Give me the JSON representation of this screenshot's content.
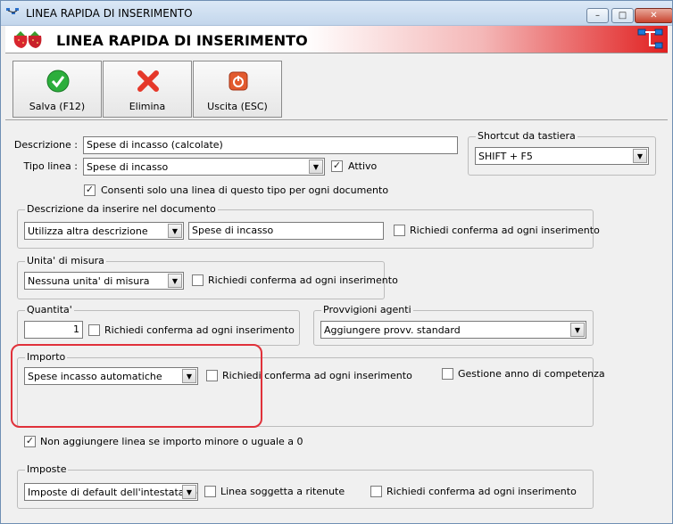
{
  "window": {
    "title": "LINEA RAPIDA DI INSERIMENTO",
    "minimize": "–",
    "maximize": "□",
    "close": "✕"
  },
  "banner": {
    "title": "LINEA RAPIDA DI INSERIMENTO"
  },
  "toolbar": {
    "save_label": "Salva (F12)",
    "delete_label": "Elimina",
    "exit_label": "Uscita (ESC)"
  },
  "form": {
    "description_label": "Descrizione :",
    "description_value": "Spese di incasso  (calcolate)",
    "type_label": "Tipo linea :",
    "type_value": "Spese di incasso",
    "active_label": "Attivo",
    "active_checked": true,
    "single_line_label": "Consenti solo una linea di questo tipo per ogni documento",
    "single_line_checked": true
  },
  "shortcut": {
    "legend": "Shortcut da tastiera",
    "value": "SHIFT + F5"
  },
  "descrizione_doc": {
    "legend": "Descrizione da inserire nel documento",
    "mode_value": "Utilizza altra descrizione",
    "text_value": "Spese di incasso",
    "confirm_label": "Richiedi conferma ad ogni inserimento"
  },
  "unita": {
    "legend": "Unita' di misura",
    "value": "Nessuna unita' di misura",
    "confirm_label": "Richiedi conferma ad ogni inserimento"
  },
  "quantita": {
    "legend": "Quantita'",
    "value": "1",
    "confirm_label": "Richiedi conferma ad ogni inserimento"
  },
  "provvigioni": {
    "legend": "Provvigioni agenti",
    "value": "Aggiungere provv. standard"
  },
  "importo": {
    "legend": "Importo",
    "value": "Spese incasso automatiche",
    "confirm_label": "Richiedi conferma ad ogni inserimento",
    "gestione_label": "Gestione anno di competenza",
    "no_add_label": "Non aggiungere linea se importo minore o uguale a 0",
    "no_add_checked": true
  },
  "imposte": {
    "legend": "Imposte",
    "value": "Imposte di default dell'intestatario",
    "ritenute_label": "Linea soggetta a ritenute",
    "confirm_label": "Richiedi conferma ad ogni inserimento"
  }
}
